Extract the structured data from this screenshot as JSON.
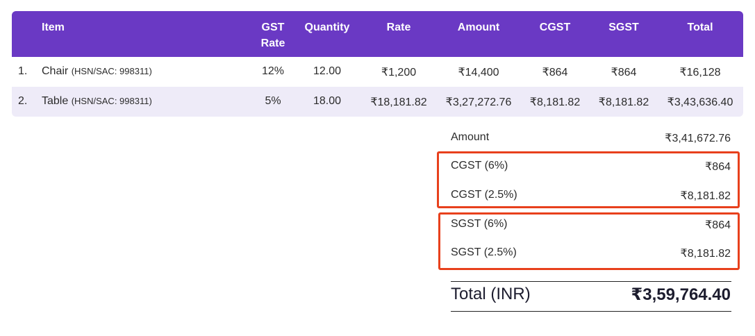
{
  "table": {
    "headers": {
      "item": "Item",
      "gst_rate_line1": "GST",
      "gst_rate_line2": "Rate",
      "quantity": "Quantity",
      "rate": "Rate",
      "amount": "Amount",
      "cgst": "CGST",
      "sgst": "SGST",
      "total": "Total"
    },
    "rows": [
      {
        "index": "1.",
        "item": "Chair",
        "hsn": "(HSN/SAC: 998311)",
        "gst_rate": "12%",
        "quantity": "12.00",
        "rate": "₹1,200",
        "amount": "₹14,400",
        "cgst": "₹864",
        "sgst": "₹864",
        "total": "₹16,128"
      },
      {
        "index": "2.",
        "item": "Table",
        "hsn": "(HSN/SAC: 998311)",
        "gst_rate": "5%",
        "quantity": "18.00",
        "rate": "₹18,181.82",
        "amount": "₹3,27,272.76",
        "cgst": "₹8,181.82",
        "sgst": "₹8,181.82",
        "total": "₹3,43,636.40"
      }
    ]
  },
  "summary": {
    "amount_label": "Amount",
    "amount_value": "₹3,41,672.76",
    "cgst_6_label": "CGST (6%)",
    "cgst_6_value": "₹864",
    "cgst_25_label": "CGST (2.5%)",
    "cgst_25_value": "₹8,181.82",
    "sgst_6_label": "SGST (6%)",
    "sgst_6_value": "₹864",
    "sgst_25_label": "SGST (2.5%)",
    "sgst_25_value": "₹8,181.82",
    "total_label": "Total (INR)",
    "total_value": "₹3,59,764.40"
  },
  "colors": {
    "header_bg": "#6a39c4",
    "alt_row_bg": "#eeebf8",
    "highlight_border": "#e8401c"
  }
}
